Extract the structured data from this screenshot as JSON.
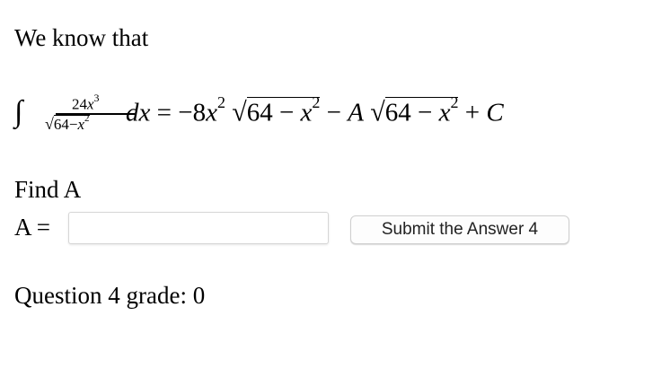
{
  "intro_text": "We know that",
  "formula": {
    "integral_sign": "∫",
    "num_coef": "24",
    "num_var": "x",
    "num_exp": "3",
    "den_radical": "√",
    "den_const": "64",
    "den_minus": "−",
    "den_var": "x",
    "den_exp": "2",
    "dx": "dx",
    "equals": " = ",
    "term1_sign": "−",
    "term1_coef": "8",
    "term1_var": "x",
    "term1_exp": "2",
    "radical": "√",
    "root_const": "64",
    "root_minus": " − ",
    "root_var": "x",
    "root_exp": "2",
    "minus": " − ",
    "unknown": "A",
    "plus": " + ",
    "constant": "C"
  },
  "find_text": "Find A",
  "answer_label": "A =",
  "answer": {
    "value": "",
    "placeholder": ""
  },
  "submit_label": "Submit the Answer 4",
  "grade_text": "Question 4 grade: 0"
}
